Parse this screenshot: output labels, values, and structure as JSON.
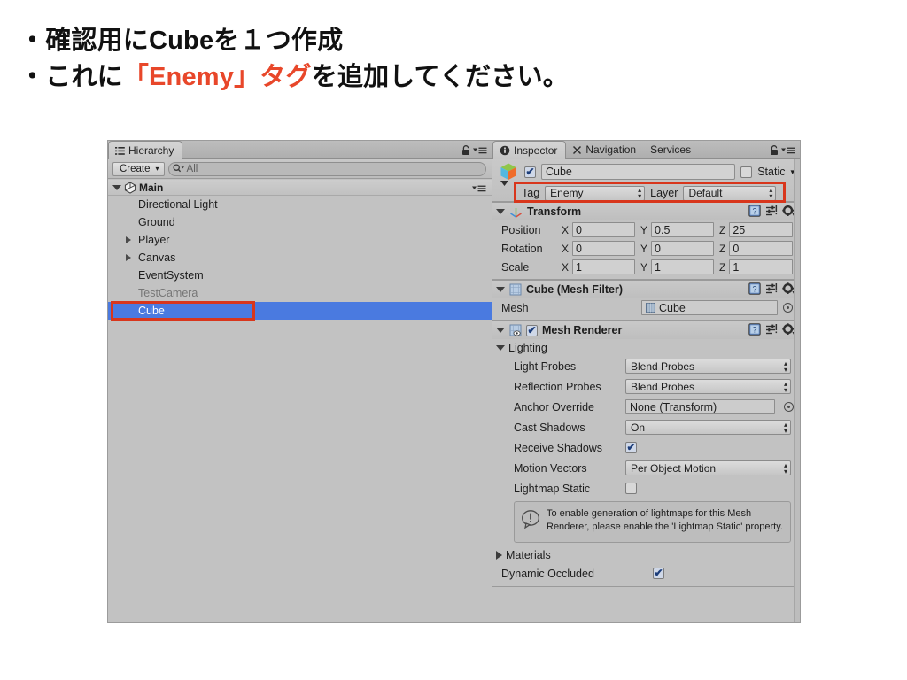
{
  "slide": {
    "lines": [
      {
        "bullet": "・",
        "segments": [
          {
            "text": "確認用にCubeを１つ作成",
            "accent": false
          }
        ]
      },
      {
        "bullet": "・",
        "segments": [
          {
            "text": "これに",
            "accent": false
          },
          {
            "text": "「Enemy」タグ",
            "accent": true
          },
          {
            "text": "を追加してください。",
            "accent": false
          }
        ]
      }
    ],
    "line1_plain": "・確認用にCubeを１つ作成",
    "line2_pre": "・これに",
    "line2_accent": "「Enemy」タグ",
    "line2_post": "を追加してください。",
    "accent_color": "#e8472a"
  },
  "hierarchy": {
    "tab_label": "Hierarchy",
    "tab_icon": "hierarchy-icon",
    "lock_icon": "lock-icon",
    "menu_icon": "menu-icon",
    "create_button": "Create",
    "create_arrow": "▾",
    "search_placeholder": "All",
    "search_icon": "search-icon",
    "scene_row": {
      "label": "Main",
      "icon": "unity-scene-icon",
      "expanded": true
    },
    "items": [
      {
        "label": "Directional Light",
        "indent": 1,
        "expandable": false,
        "dim": false,
        "selected": false
      },
      {
        "label": "Ground",
        "indent": 1,
        "expandable": false,
        "dim": false,
        "selected": false
      },
      {
        "label": "Player",
        "indent": 1,
        "expandable": true,
        "dim": false,
        "selected": false
      },
      {
        "label": "Canvas",
        "indent": 1,
        "expandable": true,
        "dim": false,
        "selected": false
      },
      {
        "label": "EventSystem",
        "indent": 1,
        "expandable": false,
        "dim": false,
        "selected": false
      },
      {
        "label": "TestCamera",
        "indent": 1,
        "expandable": false,
        "dim": true,
        "selected": false
      },
      {
        "label": "Cube",
        "indent": 1,
        "expandable": false,
        "dim": false,
        "selected": true
      }
    ],
    "selection_color": "#4a7ae0",
    "highlight_color": "#d8361c"
  },
  "inspector": {
    "tabs": [
      {
        "label": "Inspector",
        "icon": "info-icon",
        "active": true
      },
      {
        "label": "Navigation",
        "icon": "navigation-icon",
        "active": false
      },
      {
        "label": "Services",
        "icon": "",
        "active": false
      }
    ],
    "lock_icon": "lock-icon",
    "menu_icon": "menu-icon",
    "object": {
      "icon": "cube-prefab-icon",
      "enabled": true,
      "name": "Cube",
      "static_label": "Static",
      "static_checked": false,
      "static_arrow": "▾"
    },
    "tag_row": {
      "tag_label": "Tag",
      "tag_value": "Enemy",
      "layer_label": "Layer",
      "layer_value": "Default",
      "highlighted": true
    },
    "transform": {
      "title": "Transform",
      "icon": "transform-axis-icon",
      "expanded": true,
      "rows": [
        {
          "label": "Position",
          "x": "0",
          "y": "0.5",
          "z": "25"
        },
        {
          "label": "Rotation",
          "x": "0",
          "y": "0",
          "z": "0"
        },
        {
          "label": "Scale",
          "x": "1",
          "y": "1",
          "z": "1"
        }
      ],
      "axes": [
        "X",
        "Y",
        "Z"
      ],
      "header_icons": [
        "help-icon",
        "preset-icon",
        "gear-icon"
      ]
    },
    "mesh_filter": {
      "title": "Cube (Mesh Filter)",
      "icon": "mesh-filter-icon",
      "expanded": true,
      "mesh_label": "Mesh",
      "mesh_value": "Cube",
      "mesh_value_icon": "mesh-icon",
      "picker_icon": "object-picker-icon",
      "header_icons": [
        "help-icon",
        "preset-icon",
        "gear-icon"
      ]
    },
    "mesh_renderer": {
      "title": "Mesh Renderer",
      "icon": "mesh-renderer-icon",
      "enabled": true,
      "expanded": true,
      "lighting_label": "Lighting",
      "header_icons": [
        "help-icon",
        "preset-icon",
        "gear-icon"
      ],
      "properties": [
        {
          "label": "Light Probes",
          "type": "dropdown",
          "value": "Blend Probes"
        },
        {
          "label": "Reflection Probes",
          "type": "dropdown",
          "value": "Blend Probes"
        },
        {
          "label": "Anchor Override",
          "type": "object",
          "value": "None (Transform)"
        },
        {
          "label": "Cast Shadows",
          "type": "dropdown",
          "value": "On"
        },
        {
          "label": "Receive Shadows",
          "type": "checkbox",
          "checked": true
        },
        {
          "label": "Motion Vectors",
          "type": "dropdown",
          "value": "Per Object Motion"
        },
        {
          "label": "Lightmap Static",
          "type": "checkbox",
          "checked": false
        }
      ],
      "help_box": {
        "icon": "info-bubble-icon",
        "text": "To enable generation of lightmaps for this Mesh Renderer, please enable the 'Lightmap Static' property."
      },
      "materials_label": "Materials",
      "materials_expanded": false,
      "dynamic_occluded_label": "Dynamic Occluded",
      "dynamic_occluded_checked": true
    }
  }
}
